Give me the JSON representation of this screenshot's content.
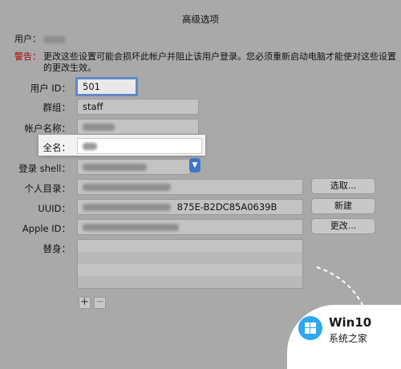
{
  "dialog": {
    "title": "高级选项",
    "user_label": "用户：",
    "warning_label": "警告：",
    "warning_text_line1": "更改这些设置可能会损坏此帐户并阻止该用户登录。您必须重新启动电脑才能使对这些设置",
    "warning_text_line2": "的更改生效。"
  },
  "fields": {
    "user_id": {
      "label": "用户 ID：",
      "value": "501"
    },
    "group": {
      "label": "群组：",
      "value": "staff"
    },
    "account_name": {
      "label": "帐户名称："
    },
    "full_name": {
      "label": "全名："
    },
    "login_shell": {
      "label": "登录 shell："
    },
    "home_dir": {
      "label": "个人目录："
    },
    "uuid": {
      "label": "UUID：",
      "value_suffix": "875E-B2DC85A0639B"
    },
    "apple_id": {
      "label": "Apple ID："
    },
    "aliases": {
      "label": "替身："
    }
  },
  "buttons": {
    "choose": "选取...",
    "new": "新建",
    "change": "更改..."
  },
  "list_controls": {
    "add": "+",
    "remove": "−"
  },
  "watermark": {
    "brand": "Win10",
    "sub": "系统之家"
  }
}
